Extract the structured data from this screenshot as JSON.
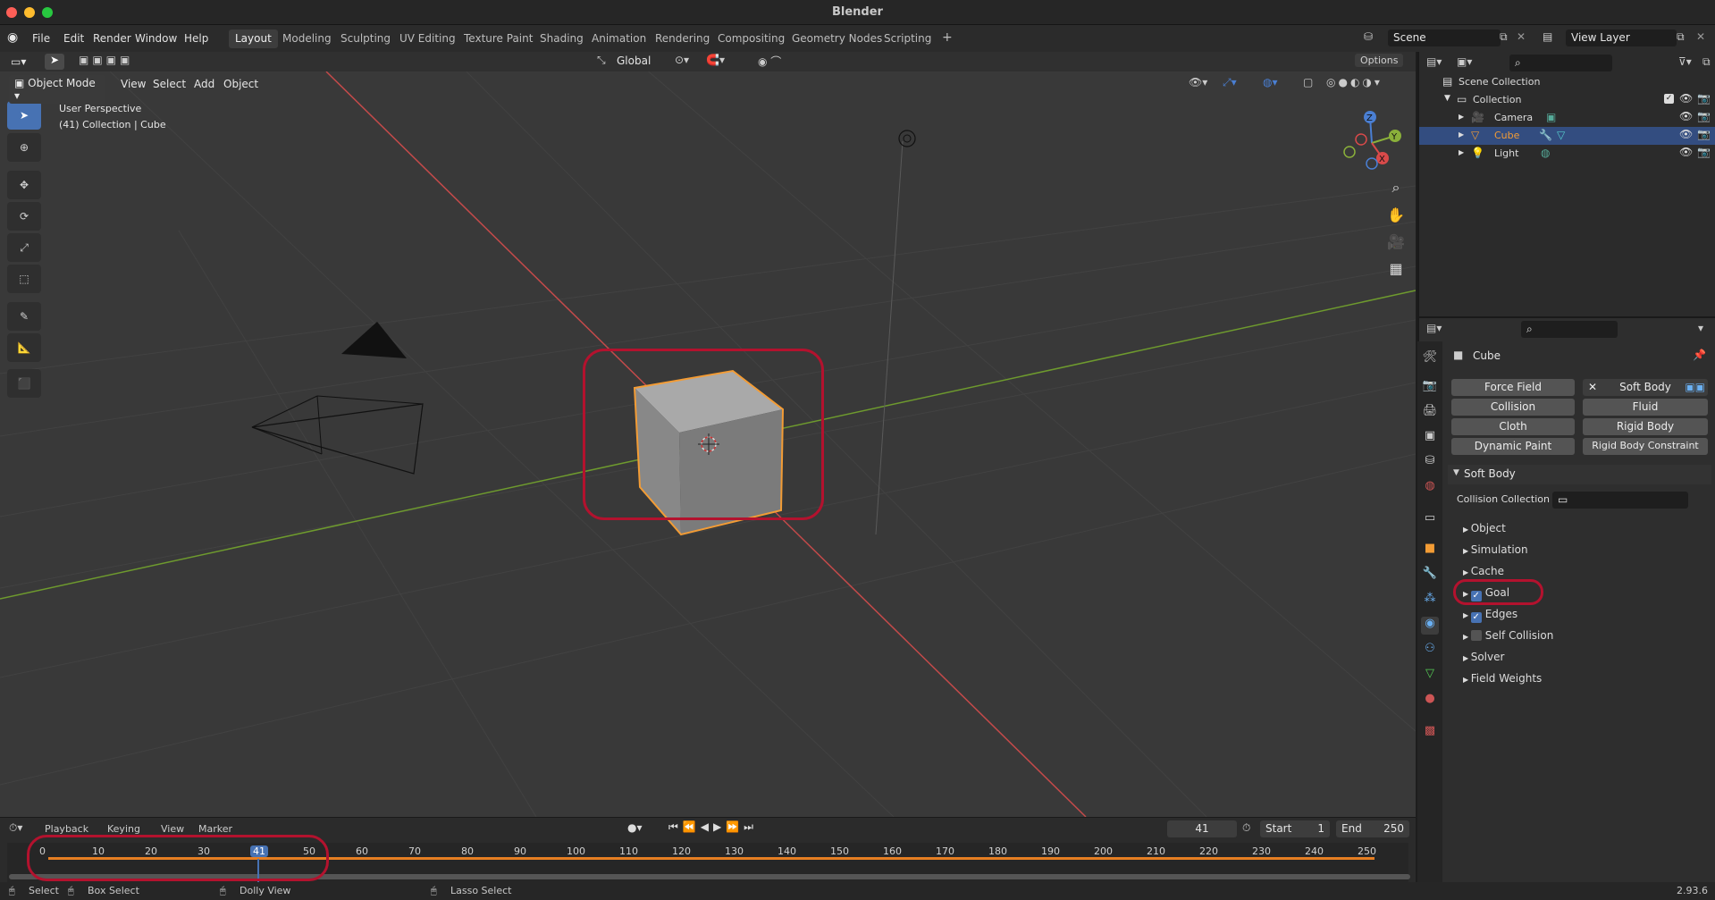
{
  "window": {
    "title": "Blender"
  },
  "menu": {
    "items": [
      "File",
      "Edit",
      "Render",
      "Window",
      "Help"
    ]
  },
  "workspaces": {
    "tabs": [
      "Layout",
      "Modeling",
      "Sculpting",
      "UV Editing",
      "Texture Paint",
      "Shading",
      "Animation",
      "Rendering",
      "Compositing",
      "Geometry Nodes",
      "Scripting"
    ],
    "active": "Layout",
    "add_label": "+"
  },
  "topright": {
    "scene": "Scene",
    "view_layer": "View Layer"
  },
  "viewport_header": {
    "mode": "Object Mode",
    "menus": [
      "View",
      "Select",
      "Add",
      "Object"
    ],
    "orientation": "Global",
    "options": "Options"
  },
  "viewport": {
    "perspective": "User Perspective",
    "collection_info": "(41) Collection | Cube",
    "gizmo_axes": {
      "x": "X",
      "y": "Y",
      "z": "Z"
    }
  },
  "colors": {
    "accent": "#4772b3",
    "selection_outline": "#f39c35",
    "annotation": "#b3122e",
    "x_axis": "#c44a4a",
    "y_axis": "#6e9a2e"
  },
  "outliner": {
    "search_placeholder": "",
    "rows": [
      {
        "label": "Scene Collection"
      },
      {
        "label": "Collection"
      },
      {
        "label": "Camera"
      },
      {
        "label": "Cube"
      },
      {
        "label": "Light"
      }
    ]
  },
  "properties": {
    "object_name": "Cube",
    "physics_buttons": {
      "force_field": "Force Field",
      "soft_body": "Soft Body",
      "collision": "Collision",
      "fluid": "Fluid",
      "cloth": "Cloth",
      "rigid_body": "Rigid Body",
      "dynamic_paint": "Dynamic Paint",
      "rigid_body_constraint": "Rigid Body Constraint"
    },
    "panel_title": "Soft Body",
    "collision_collection_label": "Collision Collection",
    "subpanels": [
      {
        "label": "Object",
        "checkbox": null
      },
      {
        "label": "Simulation",
        "checkbox": null
      },
      {
        "label": "Cache",
        "checkbox": null
      },
      {
        "label": "Goal",
        "checkbox": true
      },
      {
        "label": "Edges",
        "checkbox": true
      },
      {
        "label": "Self Collision",
        "checkbox": false
      },
      {
        "label": "Solver",
        "checkbox": null
      },
      {
        "label": "Field Weights",
        "checkbox": null
      }
    ]
  },
  "timeline": {
    "menus": [
      "Playback",
      "Keying",
      "View",
      "Marker"
    ],
    "current_frame": "41",
    "start_label": "Start",
    "start": "1",
    "end_label": "End",
    "end": "250",
    "ruler": [
      "0",
      "10",
      "20",
      "30",
      "41",
      "50",
      "60",
      "70",
      "80",
      "90",
      "100",
      "110",
      "120",
      "130",
      "140",
      "150",
      "160",
      "170",
      "180",
      "190",
      "200",
      "210",
      "220",
      "230",
      "240",
      "250"
    ]
  },
  "statusbar": {
    "select": "Select",
    "box_select": "Box Select",
    "dolly_view": "Dolly View",
    "lasso_select": "Lasso Select",
    "version": "2.93.6"
  }
}
